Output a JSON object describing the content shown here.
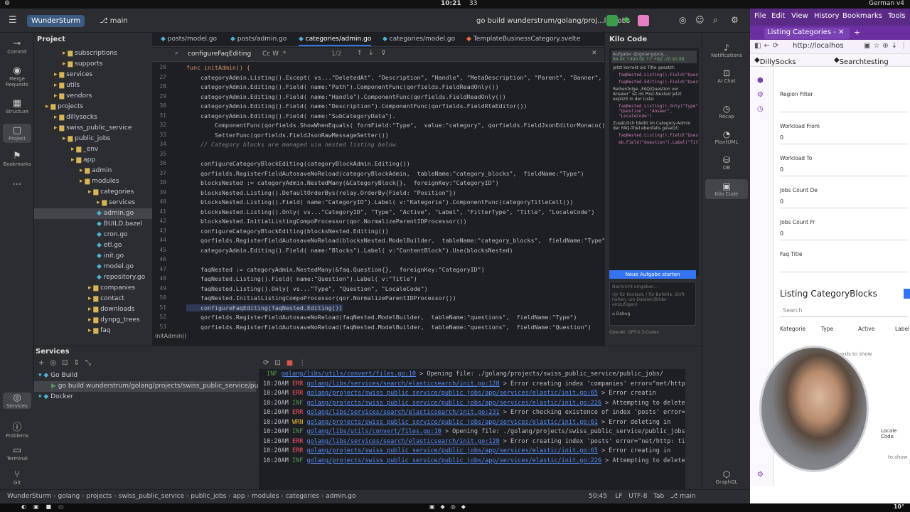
{
  "topbar": {
    "time": "10:21",
    "count": "33",
    "lang": "German",
    "version": "v4"
  },
  "ide": {
    "project": "WunderSturm",
    "branch": "main",
    "run_config": "go build wunderstrum/golang/proj...lic_jobs",
    "left_tools": [
      "Commit",
      "Merge Requests",
      "Structure",
      "Project",
      "Bookmarks"
    ],
    "project_panel": {
      "title": "Project",
      "items": [
        {
          "label": "subscriptions",
          "type": "folder",
          "depth": 3
        },
        {
          "label": "supports",
          "type": "folder",
          "depth": 3
        },
        {
          "label": "services",
          "type": "folder",
          "depth": 2
        },
        {
          "label": "utils",
          "type": "folder",
          "depth": 2
        },
        {
          "label": "vendors",
          "type": "folder",
          "depth": 2
        },
        {
          "label": "projects",
          "type": "folder",
          "depth": 1
        },
        {
          "label": "dillysocks",
          "type": "folder",
          "depth": 2
        },
        {
          "label": "swiss_public_service",
          "type": "folder",
          "depth": 2
        },
        {
          "label": "public_jobs",
          "type": "folder",
          "depth": 3
        },
        {
          "label": "_env",
          "type": "folder",
          "depth": 4
        },
        {
          "label": "app",
          "type": "folder",
          "depth": 4
        },
        {
          "label": "admin",
          "type": "folder",
          "depth": 5
        },
        {
          "label": "modules",
          "type": "folder",
          "depth": 5
        },
        {
          "label": "categories",
          "type": "folder",
          "depth": 6
        },
        {
          "label": "services",
          "type": "folder",
          "depth": 7
        },
        {
          "label": "admin.go",
          "type": "go",
          "depth": 7,
          "selected": true
        },
        {
          "label": "BUILD.bazel",
          "type": "file",
          "depth": 7
        },
        {
          "label": "cron.go",
          "type": "go",
          "depth": 7
        },
        {
          "label": "etl.go",
          "type": "go",
          "depth": 7
        },
        {
          "label": "init.go",
          "type": "go",
          "depth": 7
        },
        {
          "label": "model.go",
          "type": "go",
          "depth": 7
        },
        {
          "label": "repository.go",
          "type": "go",
          "depth": 7
        },
        {
          "label": "companies",
          "type": "folder",
          "depth": 6
        },
        {
          "label": "contact",
          "type": "folder",
          "depth": 6
        },
        {
          "label": "downloads",
          "type": "folder",
          "depth": 6
        },
        {
          "label": "dynpg_trees",
          "type": "folder",
          "depth": 6
        },
        {
          "label": "faq",
          "type": "folder",
          "depth": 6
        }
      ]
    },
    "tabs": [
      "posts/model.go",
      "posts/admin.go",
      "categories/admin.go",
      "categories/model.go",
      "TemplateBusinessCategory.svelte"
    ],
    "find": {
      "query": "configureFaqEditing",
      "opts": "Cc  W  .*",
      "count": "1/2"
    },
    "code": [
      {
        "n": "20",
        "t": "func initAdmin() {"
      },
      {
        "n": "27",
        "t": "    categoryAdmin.Listing().Except( vs...\"DeletedAt\", \"Description\", \"Handle\", \"MetaDescription\", \"Parent\", \"Banner\","
      },
      {
        "n": "28",
        "t": "    categoryAdmin.Editing().Field( name:\"Path\").ComponentFunc(qorfields.FieldReadOnly())"
      },
      {
        "n": "29",
        "t": "    categoryAdmin.Editing().Field( name:\"Handle\").ComponentFunc(qorfields.FieldReadOnly())"
      },
      {
        "n": "30",
        "t": "    categoryAdmin.Editing().Field( name:\"Description\").ComponentFunc(qorfields.FieldRteEditor())"
      },
      {
        "n": "31",
        "t": "    categoryAdmin.Editing().Field( name:\"SubCategoryData\")."
      },
      {
        "n": "32",
        "t": "        ComponentFunc(qorfields.ShowWhenEquals( formField:\"Type\",  value:\"category\", qorfields.FieldJsonEditorMonaco())),"
      },
      {
        "n": "33",
        "t": "        SetterFunc(qorfields.FieldJsonRawMessageSetter())"
      },
      {
        "n": "34",
        "t": "    // Category blocks are managed via nested listing below."
      },
      {
        "n": "35",
        "t": ""
      },
      {
        "n": "36",
        "t": "    configureCategoryBlockEditing(categoryBlockAdmin.Editing())"
      },
      {
        "n": "37",
        "t": "    qorfields.RegisterFieldAutosaveNoReload(categoryBlockAdmin,  tableName:\"category_blocks\",  fieldName:\"Type\")"
      },
      {
        "n": "38",
        "t": "    blocksNested := categoryAdmin.NestedMany(&CategoryBlock{},  foreignKey:\"CategoryID\")"
      },
      {
        "n": "39",
        "t": "    blocksNested.Listing().DefaultOrderBys(relay.OrderBy{Field: \"Position\"})"
      },
      {
        "n": "40",
        "t": "    blocksNested.Listing().Field( name:\"CategoryID\").Label( v:\"Kategorie\").ComponentFunc(categoryTitleCell())"
      },
      {
        "n": "41",
        "t": "    blocksNested.Listing().Only( vs...\"CategoryID\", \"Type\", \"Active\", \"Label\", \"FilterType\", \"Title\", \"LocaleCode\")"
      },
      {
        "n": "42",
        "t": "    blocksNested.InitialListingCompoProcessor(qor.NormalizeParentIDProcessor())"
      },
      {
        "n": "43",
        "t": "    configureCategoryBlockEditing(blocksNested.Editing())"
      },
      {
        "n": "44",
        "t": "    qorfields.RegisterFieldAutosaveNoReload(blocksNested.ModelBuilder,  tableName:\"category_blocks\",  fieldName:\"Type\")"
      },
      {
        "n": "45",
        "t": "    categoryAdmin.Editing().Field( name:\"Blocks\").Label( v:\"ContentBlock\").Use(blocksNested)"
      },
      {
        "n": "46",
        "t": ""
      },
      {
        "n": "47",
        "t": "    faqNested := categoryAdmin.NestedMany(&faq.Question{},  foreignKey:\"CategoryID\")"
      },
      {
        "n": "48",
        "t": "    faqNested.Listing().Field( name:\"Question\").Label( v:\"Title\")"
      },
      {
        "n": "49",
        "t": "    faqNested.Listing().Only( vs...\"Type\", \"Question\", \"LocaleCode\")"
      },
      {
        "n": "50",
        "t": "    faqNested.InitialListingCompoProcessor(qor.NormalizeParentIDProcessor())"
      },
      {
        "n": "51",
        "t": "    configureFaqEditing(faqNested.Editing())"
      },
      {
        "n": "52",
        "t": "    qorfields.RegisterFieldAutosaveNoReload(faqNested.ModelBuilder,  tableName:\"questions\",  fieldName:\"Type\")"
      },
      {
        "n": "53",
        "t": "    qorfields.RegisterFieldAutosaveNoReload(faqNested.ModelBuilder,  tableName:\"questions\",  fieldName:\"Question\")"
      }
    ],
    "breadcrumb_fn": "initAdmin()",
    "kilo": {
      "title": "Kilo Code",
      "task": "Aufgabe: @/golang/proj...",
      "stats": "84.4k  ↑400.0k  ↑7  +82  -70  $0.88",
      "msgs": [
        "jetzt korrekt als Title gesetzt:",
        "faqNested.Listing().Field(\"Question\").Label(\"Title\")",
        "faqNested.Editing().Field(\"Question\").Label(\"Title\")",
        "Reihenfolge „FAQ/Question vor Answer“ ist im Post-Nested jetzt explizit in der Liste:",
        "faqNested.Listing().Only(\"Type\", \"Question\", \"Answer\", \"LocaleCode\")",
        "Zusätzlich bleibt im Category-Admin der FAQ-Titel ebenfalls gesetzt:",
        "faqNested.Listing().Field(\"Question\").Label(\"Title\")",
        "eb.Field(\"Question\").Label(\"Title\")"
      ],
      "new_task": "Neue Aufgabe starten",
      "input_ph": "Nachricht eingeben...",
      "input_hint": "(@ für Kontext, / für Befehle, Shift halten, um Dateien/Bilder einzufügen)",
      "mode": "Debug",
      "model": "OpenAI: GPT-5.3-Codex"
    },
    "right_tools": [
      "Notifications",
      "AI Chat",
      "Recap",
      "PlantUML",
      "DB",
      "Kilo Code",
      "GraphQL"
    ],
    "services": {
      "title": "Services",
      "tree": [
        {
          "label": "Go Build",
          "depth": 0
        },
        {
          "label": "go build wunderstrum/golang/projects/swiss_public_service/publ",
          "depth": 1
        },
        {
          "label": "Docker",
          "depth": 0
        }
      ]
    },
    "logs": [
      {
        "time": "",
        "lvl": "INF",
        "file": "golang/libs/utils/convert/files.go:10",
        "msg": "Opening file: ./golang/projects/swiss_public_service/public_jobs/"
      },
      {
        "time": "10:20AM",
        "lvl": "ERR",
        "file": "golang/libs/services/search/elasticsearch/init.go:128",
        "msg": "Error creating index 'companies' error=\"net/http: t"
      },
      {
        "time": "10:20AM",
        "lvl": "ERR",
        "file": "golang/projects/swiss_public_service/public_jobs/app/services/elastic/init.go:65",
        "msg": "Error creatin"
      },
      {
        "time": "10:20AM",
        "lvl": "INF",
        "file": "golang/projects/swiss_public_service/public_jobs/app/services/elastic/init.go:226",
        "msg": "Attempting to delete index 'posts'... platform=Swi"
      },
      {
        "time": "10:20AM",
        "lvl": "ERR",
        "file": "golang/libs/services/search/elasticsearch/init.go:231",
        "msg": "Error checking existence of index 'posts' error=\"ne"
      },
      {
        "time": "10:20AM",
        "lvl": "WRN",
        "file": "golang/projects/swiss_public_service/public_jobs/app/services/elastic/init.go:61",
        "msg": "Error deleting in"
      },
      {
        "time": "10:20AM",
        "lvl": "INF",
        "file": "golang/libs/utils/convert/files.go:10",
        "msg": "Opening file: ./golang/projects/swiss_public_service/public_jobs/_e"
      },
      {
        "time": "10:20AM",
        "lvl": "ERR",
        "file": "golang/libs/services/search/elasticsearch/init.go:128",
        "msg": "Error creating index 'posts' error=\"net/http: time"
      },
      {
        "time": "10:20AM",
        "lvl": "ERR",
        "file": "golang/projects/swiss_public_service/public_jobs/app/services/elastic/init.go:65",
        "msg": "Error creating in"
      },
      {
        "time": "10:20AM",
        "lvl": "INF",
        "file": "golang/projects/swiss_public_service/public_jobs/app/services/elastic/init.go:226",
        "msg": "Attempting to delete index 'autocomplete_search'..."
      }
    ],
    "status": {
      "path": [
        "WunderSturm",
        "golang",
        "projects",
        "swiss_public_service",
        "public_jobs",
        "app",
        "modules",
        "categories",
        "admin.go"
      ],
      "pos": "50:45",
      "le": "LF",
      "enc": "UTF-8",
      "indent": "Tab",
      "branch": "main"
    }
  },
  "browser": {
    "menu": [
      "File",
      "Edit",
      "View",
      "History",
      "Bookmarks",
      "Tools"
    ],
    "tab": "Listing Categories -",
    "url": "http://localhos",
    "bookmarks": [
      "DillySocks | Server",
      "Searchtesting"
    ],
    "fields": [
      {
        "label": "Region Filter",
        "value": ""
      },
      {
        "label": "Workload From",
        "value": "0"
      },
      {
        "label": "Workload To",
        "value": "0"
      },
      {
        "label": "Jobs Count De",
        "value": "0"
      },
      {
        "label": "Jobs Count Fr",
        "value": "0"
      },
      {
        "label": "Faq Title",
        "value": ""
      }
    ],
    "listing_title": "Listing CategoryBlocks",
    "search_ph": "Search",
    "columns": [
      "Kategorie",
      "Type",
      "Active",
      "Label"
    ],
    "no_records": "No records to show",
    "locale_label": "Locale Code",
    "to_show": "to show"
  },
  "taskbar": {
    "temp": "10°"
  }
}
